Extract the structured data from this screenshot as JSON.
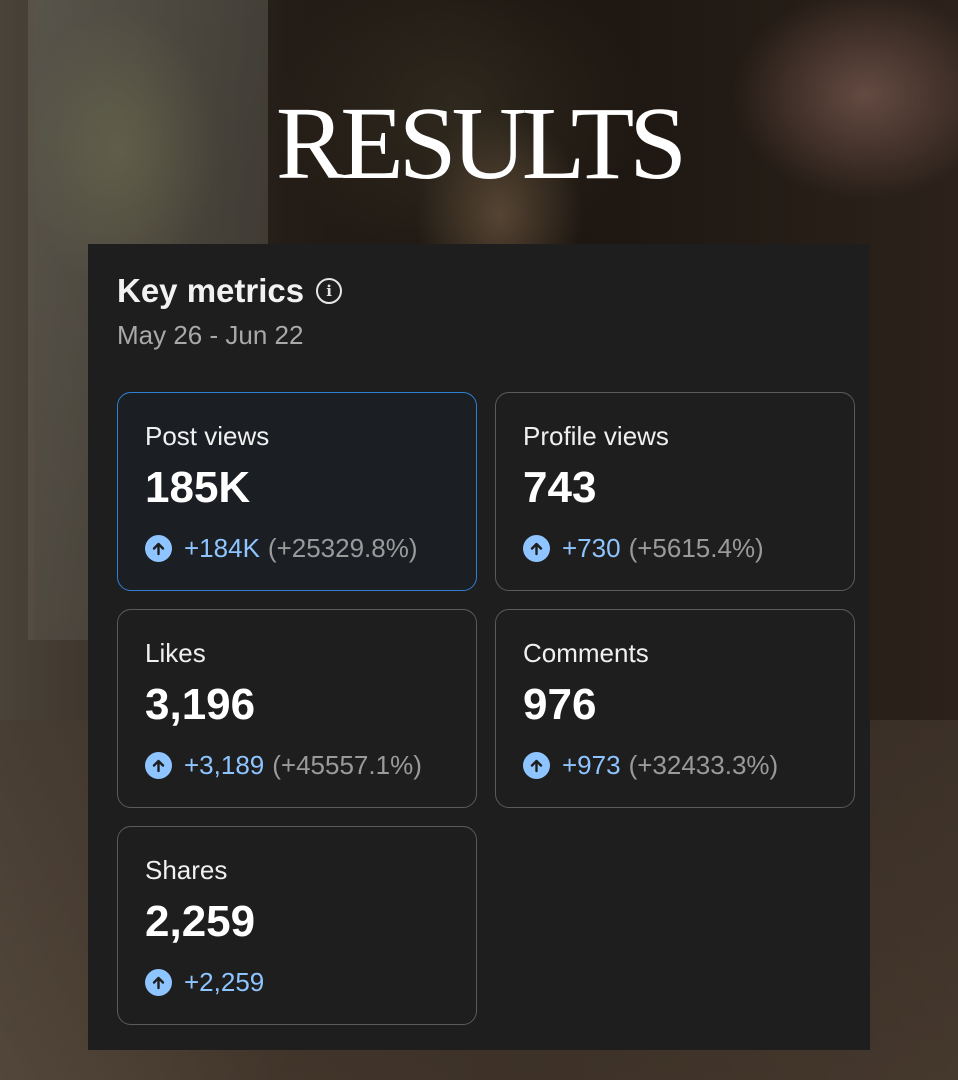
{
  "headline": "RESULTS",
  "card": {
    "title": "Key metrics",
    "info_icon": "info-icon",
    "date_range": "May 26 - Jun 22"
  },
  "metrics": [
    {
      "label": "Post views",
      "value": "185K",
      "delta": "+184K",
      "delta_pct": "(+25329.8%)",
      "selected": true
    },
    {
      "label": "Profile views",
      "value": "743",
      "delta": "+730",
      "delta_pct": "(+5615.4%)"
    },
    {
      "label": "Likes",
      "value": "3,196",
      "delta": "+3,189",
      "delta_pct": "(+45557.1%)"
    },
    {
      "label": "Comments",
      "value": "976",
      "delta": "+973",
      "delta_pct": "(+32433.3%)"
    },
    {
      "label": "Shares",
      "value": "2,259",
      "delta": "+2,259"
    }
  ],
  "colors": {
    "accent_blue": "#8ec4ff",
    "selected_border": "#2f7fd2",
    "card_background": "#1e1e1e"
  }
}
